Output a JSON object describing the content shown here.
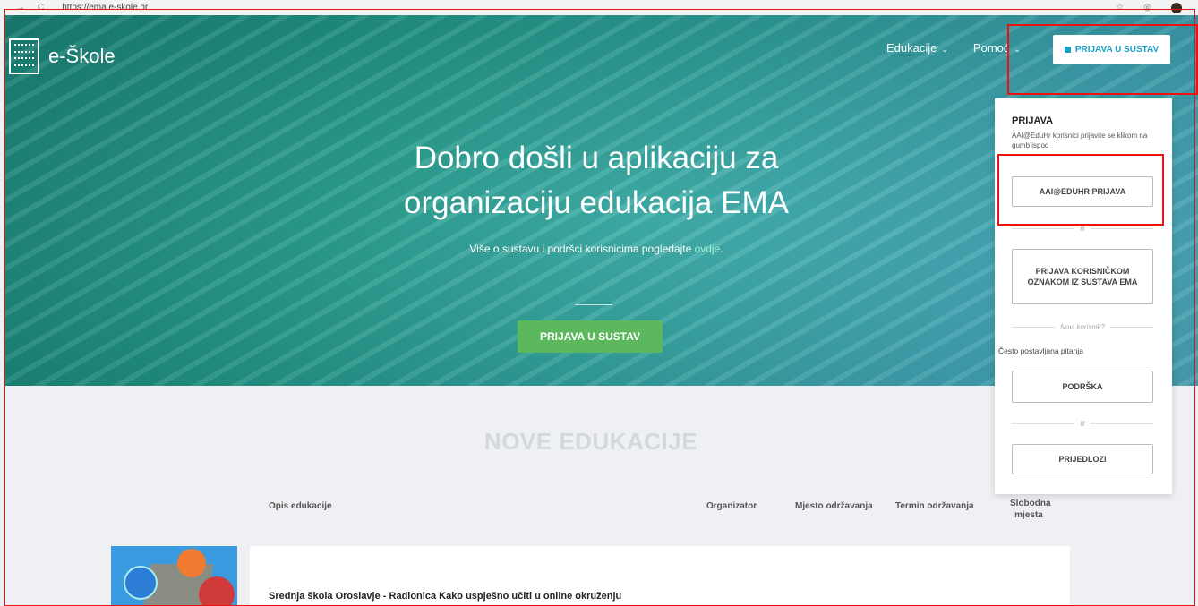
{
  "browser": {
    "url": "https://ema.e-skole.hr"
  },
  "header": {
    "logo_text": "e-Škole",
    "nav": [
      {
        "label": "Edukacije"
      },
      {
        "label": "Pomoć"
      }
    ],
    "login_button": "PRIJAVA U SUSTAV"
  },
  "hero": {
    "title_line1": "Dobro došli u aplikaciju za",
    "title_line2": "organizaciju edukacija EMA",
    "subtitle_prefix": "Više o sustavu i podršci korisnicima pogledajte ",
    "subtitle_link": "ovdje",
    "subtitle_suffix": ".",
    "cta": "PRIJAVA U SUSTAV"
  },
  "section": {
    "title": "NOVE EDUKACIJE",
    "columns": [
      "Opis edukacije",
      "Organizator",
      "Mjesto održavanja",
      "Termin održavanja",
      "Slobodna mjesta"
    ],
    "rows": [
      {
        "title": "Srednja škola Oroslavje - Radionica Kako uspješno učiti u online okruženju"
      }
    ]
  },
  "login_panel": {
    "title": "PRIJAVA",
    "info": "AAI@EduHr korisnici prijavite se klikom na gumb ispod",
    "aai_button": "AAI@EDUHR PRIJAVA",
    "sep_ili_1": "ili",
    "ema_button": "PRIJAVA KORISNIČKOM OZNAKOM IZ SUSTAVA EMA",
    "sep_new_user": "Novi korisnik?",
    "faq": "Često postavljana pitanja",
    "support_button": "PODRŠKA",
    "sep_ili_2": "ili",
    "suggestions_button": "PRIJEDLOZI"
  },
  "colors": {
    "accent_green": "#5cb85c",
    "link_blue": "#1aa0c8",
    "annotation_red": "#ee1111"
  }
}
